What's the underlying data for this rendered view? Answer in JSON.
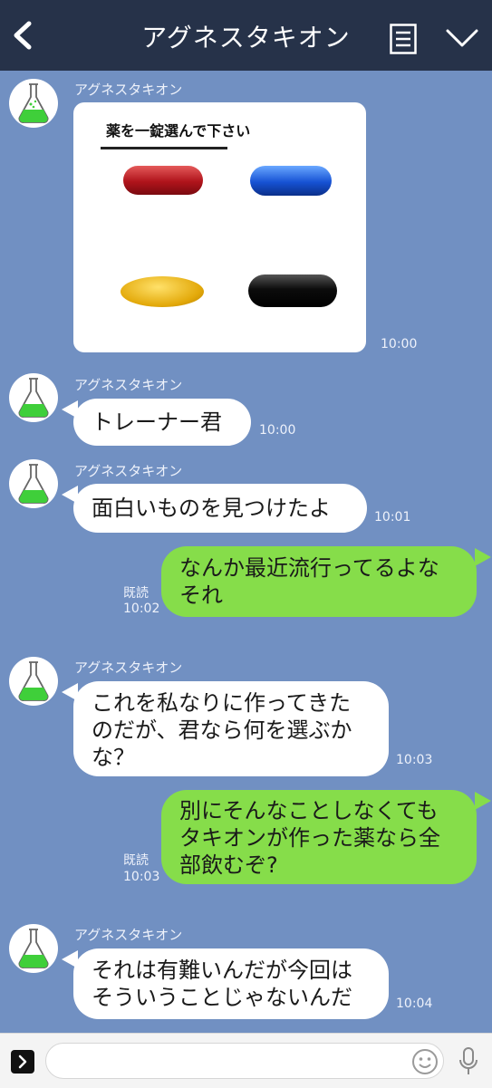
{
  "header": {
    "title": "アグネスタキオン"
  },
  "sender_name": "アグネスタキオン",
  "messages": [
    {
      "type": "image",
      "caption": "薬を一錠選んで下さい",
      "time": "10:00"
    },
    {
      "type": "text",
      "text": "トレーナー君",
      "time": "10:00"
    },
    {
      "type": "text",
      "text": "面白いものを見つけたよ",
      "time": "10:01"
    },
    {
      "type": "sent",
      "text": "なんか最近流行ってるよな\nそれ",
      "status": "既読",
      "time": "10:02"
    },
    {
      "type": "text",
      "text": "これを私なりに作ってきた\nのだが、君なら何を選ぶか\nな？",
      "time": "10:03"
    },
    {
      "type": "sent",
      "text": "別にそんなことしなくても\nタキオンが作った薬なら全\n部飲むぞ?",
      "status": "既読",
      "time": "10:03"
    },
    {
      "type": "text",
      "text": "それは有難いんだが今回は\nそういうことじゃないんだ",
      "time": "10:04"
    }
  ],
  "icons": {
    "back": "back-chevron-icon",
    "menu": "notes-icon",
    "expand": "chevron-down-icon",
    "more": "expand-arrow-icon",
    "emoji": "smiley-icon",
    "mic": "microphone-icon",
    "avatar": "flask-icon"
  },
  "colors": {
    "background": "#7190c2",
    "header": "#263249",
    "sent_bubble": "#86dd4a",
    "received_bubble": "#ffffff"
  },
  "pills": [
    "red",
    "blue",
    "yellow",
    "black"
  ]
}
